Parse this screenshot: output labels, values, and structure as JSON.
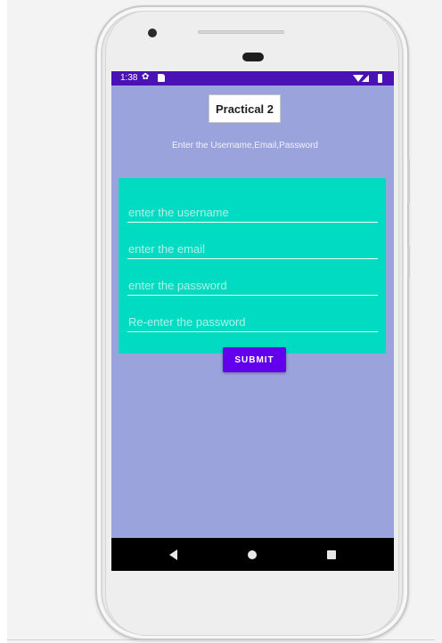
{
  "status_bar": {
    "time": "1:38",
    "icons": [
      "gear-icon",
      "sd-card-icon",
      "wifi-icon",
      "signal-icon",
      "battery-icon"
    ]
  },
  "app": {
    "title": "Practical 2",
    "instruction": "Enter the Username,Email,Password"
  },
  "form": {
    "fields": [
      {
        "placeholder": "enter the username",
        "value": ""
      },
      {
        "placeholder": "enter the email",
        "value": ""
      },
      {
        "placeholder": "enter the password",
        "value": ""
      },
      {
        "placeholder": "Re-enter the password",
        "value": ""
      }
    ],
    "submit_label": "SUBMIT"
  },
  "nav_bar": {
    "icons": [
      "back-icon",
      "home-icon",
      "recents-icon"
    ]
  },
  "colors": {
    "status_bar": "#4a12b4",
    "screen_background": "#9aa3dc",
    "form_background": "#00dbc2",
    "submit_button": "#6200ee",
    "nav_bar": "#000000"
  }
}
